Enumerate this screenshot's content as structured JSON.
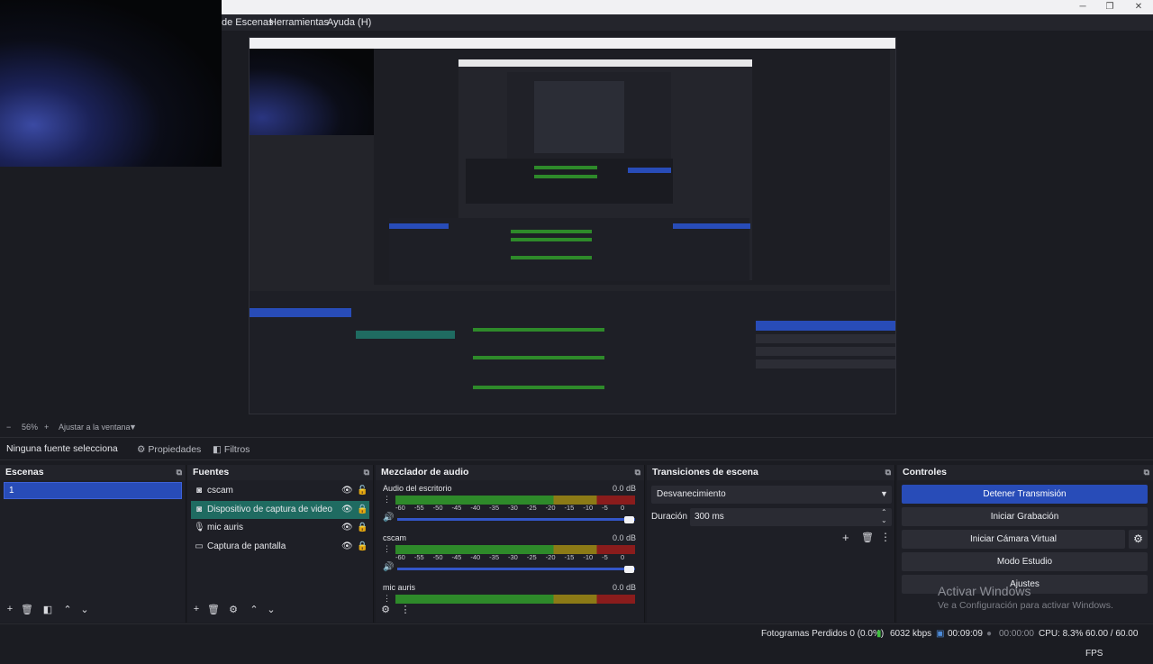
{
  "menu": {
    "items": [
      "de Escenas",
      "Herramientas",
      "Ayuda (H)"
    ]
  },
  "window_controls": {
    "minimize": "─",
    "maximize": "❐",
    "close": "✕"
  },
  "zoom": {
    "minus": "−",
    "level": "56%",
    "plus": "+",
    "fit_label": "Ajustar a la ventana",
    "dropdown": "▼"
  },
  "toolbar": {
    "no_source": "Ninguna fuente selecciona",
    "properties": "Propiedades",
    "filters": "Filtros"
  },
  "docks": {
    "scenes": {
      "title": "Escenas",
      "items": [
        "1"
      ]
    },
    "sources": {
      "title": "Fuentes",
      "items": [
        {
          "label": "cscam",
          "icon": "camera-icon",
          "glyph": "◙",
          "locked": false
        },
        {
          "label": "Dispositivo de captura de video",
          "icon": "camera-icon",
          "glyph": "◙",
          "locked": true
        },
        {
          "label": "mic auris",
          "icon": "microphone-icon",
          "glyph": "🎙",
          "locked": true
        },
        {
          "label": "Captura de pantalla",
          "icon": "monitor-icon",
          "glyph": "▭",
          "locked": true
        }
      ]
    },
    "mixer": {
      "title": "Mezclador de audio",
      "ticks": [
        "-60",
        "-55",
        "-50",
        "-45",
        "-40",
        "-35",
        "-30",
        "-25",
        "-20",
        "-15",
        "-10",
        "-5",
        "0"
      ],
      "channels": [
        {
          "name": "Audio del escritorio",
          "db": "0.0 dB"
        },
        {
          "name": "cscam",
          "db": "0.0 dB"
        },
        {
          "name": "mic auris",
          "db": "0.0 dB"
        }
      ]
    },
    "transitions": {
      "title": "Transiciones de escena",
      "selected": "Desvanecimiento",
      "duration_label": "Duración",
      "duration_value": "300 ms"
    },
    "controls": {
      "title": "Controles",
      "buttons": [
        "Detener Transmisión",
        "Iniciar Grabación",
        "Iniciar Cámara Virtual",
        "Modo Estudio",
        "Ajustes"
      ]
    }
  },
  "status": {
    "dropped_frames": "Fotogramas Perdidos 0 (0.0%)",
    "bitrate": "6032 kbps",
    "live_time": "00:09:09",
    "rec_time": "00:00:00",
    "cpu": "CPU: 8.3%",
    "fps": "60.00 / 60.00 FPS"
  },
  "watermark": {
    "title": "Activar Windows",
    "subtitle": "Ve a Configuración para activar Windows."
  },
  "colors": {
    "accent": "#284cb8",
    "selected_source": "#1f6b61",
    "meter_green": "#2e8a2a",
    "meter_yellow": "#8c7a16",
    "meter_red": "#8a1c1c"
  }
}
